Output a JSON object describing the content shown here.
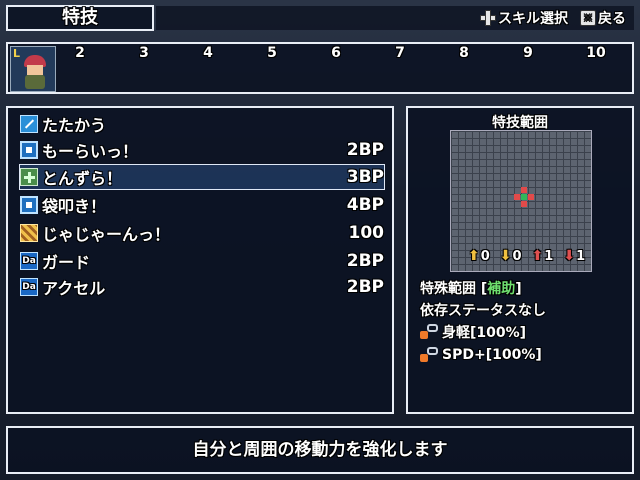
{
  "header": {
    "title": "特技",
    "hints": [
      {
        "icon": "dpad-icon",
        "label": "スキル選択"
      },
      {
        "icon": "cancel-button-icon",
        "label": "戻る"
      }
    ]
  },
  "party": {
    "leader_badge": "L",
    "slots": [
      "2",
      "3",
      "4",
      "5",
      "6",
      "7",
      "8",
      "9",
      "10"
    ]
  },
  "skills": [
    {
      "icon": "sword-icon",
      "name": "たたかう",
      "cost": ""
    },
    {
      "icon": "skill-box-icon",
      "name": "もーらいっ！",
      "cost": "2BP"
    },
    {
      "icon": "support-plus-icon",
      "name": "とんずら！",
      "cost": "3BP",
      "selected": true
    },
    {
      "icon": "skill-box-icon",
      "name": "袋叩き！",
      "cost": "4BP"
    },
    {
      "icon": "special-pattern-icon",
      "name": "じゃじゃーんっ！",
      "cost": "100"
    },
    {
      "icon": "da-icon",
      "name": "ガード",
      "cost": "2BP"
    },
    {
      "icon": "da-icon",
      "name": "アクセル",
      "cost": "2BP"
    }
  ],
  "range": {
    "title": "特技範囲",
    "center_color": "#e24a4a",
    "arrows": [
      {
        "direction": "up",
        "color": "#f0c040",
        "value": "0"
      },
      {
        "direction": "down",
        "color": "#f0c040",
        "value": "0"
      },
      {
        "direction": "up",
        "color": "#e05050",
        "value": "1"
      },
      {
        "direction": "down",
        "color": "#e05050",
        "value": "1"
      }
    ],
    "special_label": "特殊範囲",
    "special_open": "[",
    "special_value": "補助",
    "special_close": "]",
    "dependency": "依存ステータスなし",
    "buffs": [
      "身軽[100%]",
      "SPD+[100%]"
    ]
  },
  "description": "自分と周囲の移動力を強化します"
}
